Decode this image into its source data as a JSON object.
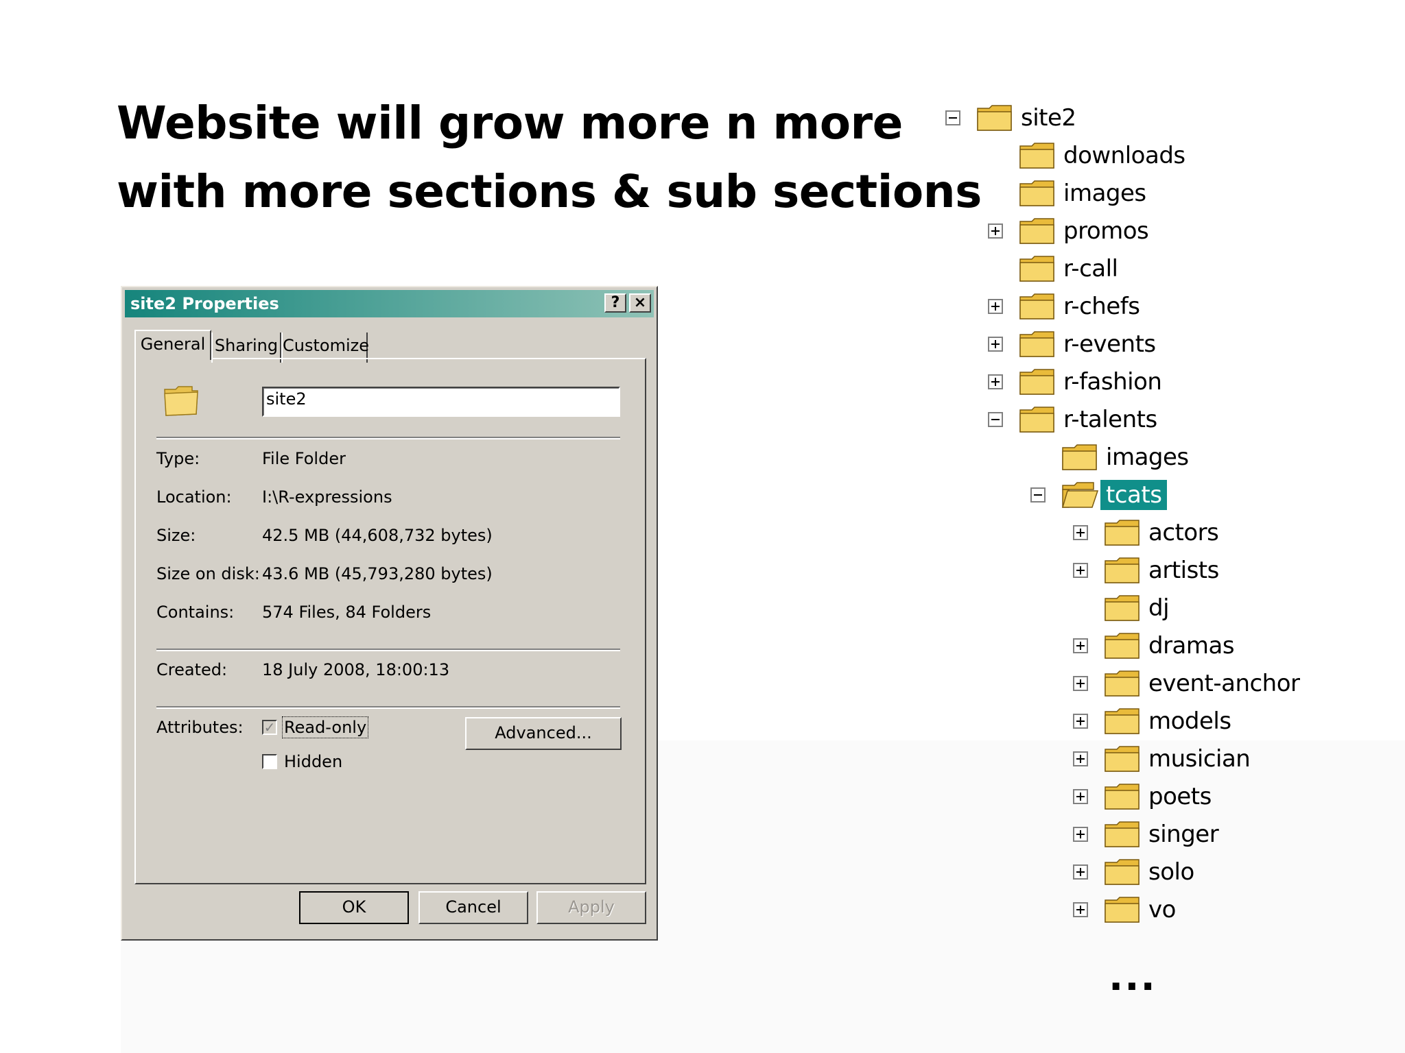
{
  "slide": {
    "title_line1": "Website will grow more n more",
    "title_line2": "with more sections & sub sections",
    "ellipsis": "..."
  },
  "dialog": {
    "title": "site2 Properties",
    "help_btn": "?",
    "close_btn": "×",
    "tabs": [
      "General",
      "Sharing",
      "Customize"
    ],
    "name_value": "site2",
    "type_label": "Type:",
    "type_value": "File Folder",
    "location_label": "Location:",
    "location_value": "I:\\R-expressions",
    "size_label": "Size:",
    "size_value": "42.5 MB (44,608,732 bytes)",
    "size_on_disk_label": "Size on disk:",
    "size_on_disk_value": "43.6 MB (45,793,280 bytes)",
    "contains_label": "Contains:",
    "contains_value": "574 Files, 84 Folders",
    "created_label": "Created:",
    "created_value": "18 July 2008, 18:00:13",
    "attributes_label": "Attributes:",
    "readonly_label": "Read-only",
    "readonly_checked": true,
    "hidden_label": "Hidden",
    "hidden_checked": false,
    "advanced_btn": "Advanced...",
    "ok_btn": "OK",
    "cancel_btn": "Cancel",
    "apply_btn": "Apply"
  },
  "tree": {
    "root": "site2",
    "nodes": [
      "downloads",
      "images",
      "promos",
      "r-call",
      "r-chefs",
      "r-events",
      "r-fashion",
      "r-talents",
      "images",
      "tcats",
      "actors",
      "artists",
      "dj",
      "dramas",
      "event-anchor",
      "models",
      "musician",
      "poets",
      "singer",
      "solo",
      "vo"
    ],
    "selected": "tcats"
  },
  "colors": {
    "dialog_face": "#d4d0c8",
    "titlebar_start": "#16857c",
    "titlebar_end": "#8fc2b6",
    "selection": "#108f8a",
    "folder": "#f2cf63"
  }
}
